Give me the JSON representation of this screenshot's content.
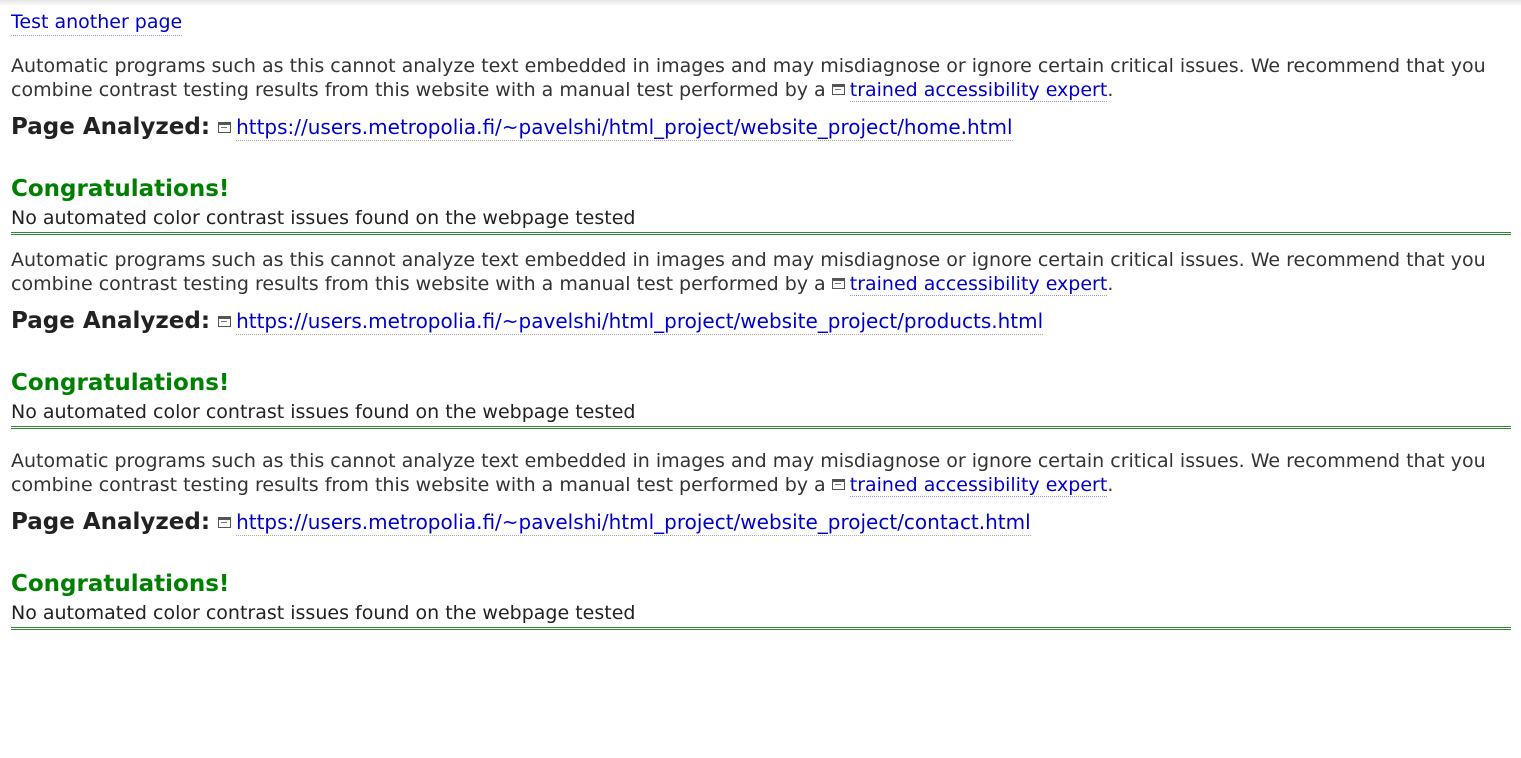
{
  "nav": {
    "test_another_label": "Test another page"
  },
  "colors": {
    "link": "#0000cc",
    "success": "#008000",
    "rule": "#2e8b2e"
  },
  "reports": [
    {
      "disclaimer_text": "Automatic programs such as this cannot analyze text embedded in images and may misdiagnose or ignore certain critical issues. We recommend that you combine contrast testing results from this website with a manual test performed by a",
      "expert_link_label": "trained accessibility expert",
      "disclaimer_end": ".",
      "analyzed_label": "Page Analyzed:",
      "analyzed_url": "https://users.metropolia.fi/~pavelshi/html_project/website_project/home.html",
      "congrats_title": "Congratulations!",
      "congrats_text": "No automated color contrast issues found on the webpage tested"
    },
    {
      "disclaimer_text": "Automatic programs such as this cannot analyze text embedded in images and may misdiagnose or ignore certain critical issues. We recommend that you combine contrast testing results from this website with a manual test performed by a",
      "expert_link_label": "trained accessibility expert",
      "disclaimer_end": ".",
      "analyzed_label": "Page Analyzed:",
      "analyzed_url": "https://users.metropolia.fi/~pavelshi/html_project/website_project/products.html",
      "congrats_title": "Congratulations!",
      "congrats_text": "No automated color contrast issues found on the webpage tested"
    },
    {
      "disclaimer_text": "Automatic programs such as this cannot analyze text embedded in images and may misdiagnose or ignore certain critical issues. We recommend that you combine contrast testing results from this website with a manual test performed by a",
      "expert_link_label": "trained accessibility expert",
      "disclaimer_end": ".",
      "analyzed_label": "Page Analyzed:",
      "analyzed_url": "https://users.metropolia.fi/~pavelshi/html_project/website_project/contact.html",
      "congrats_title": "Congratulations!",
      "congrats_text": "No automated color contrast issues found on the webpage tested"
    }
  ]
}
